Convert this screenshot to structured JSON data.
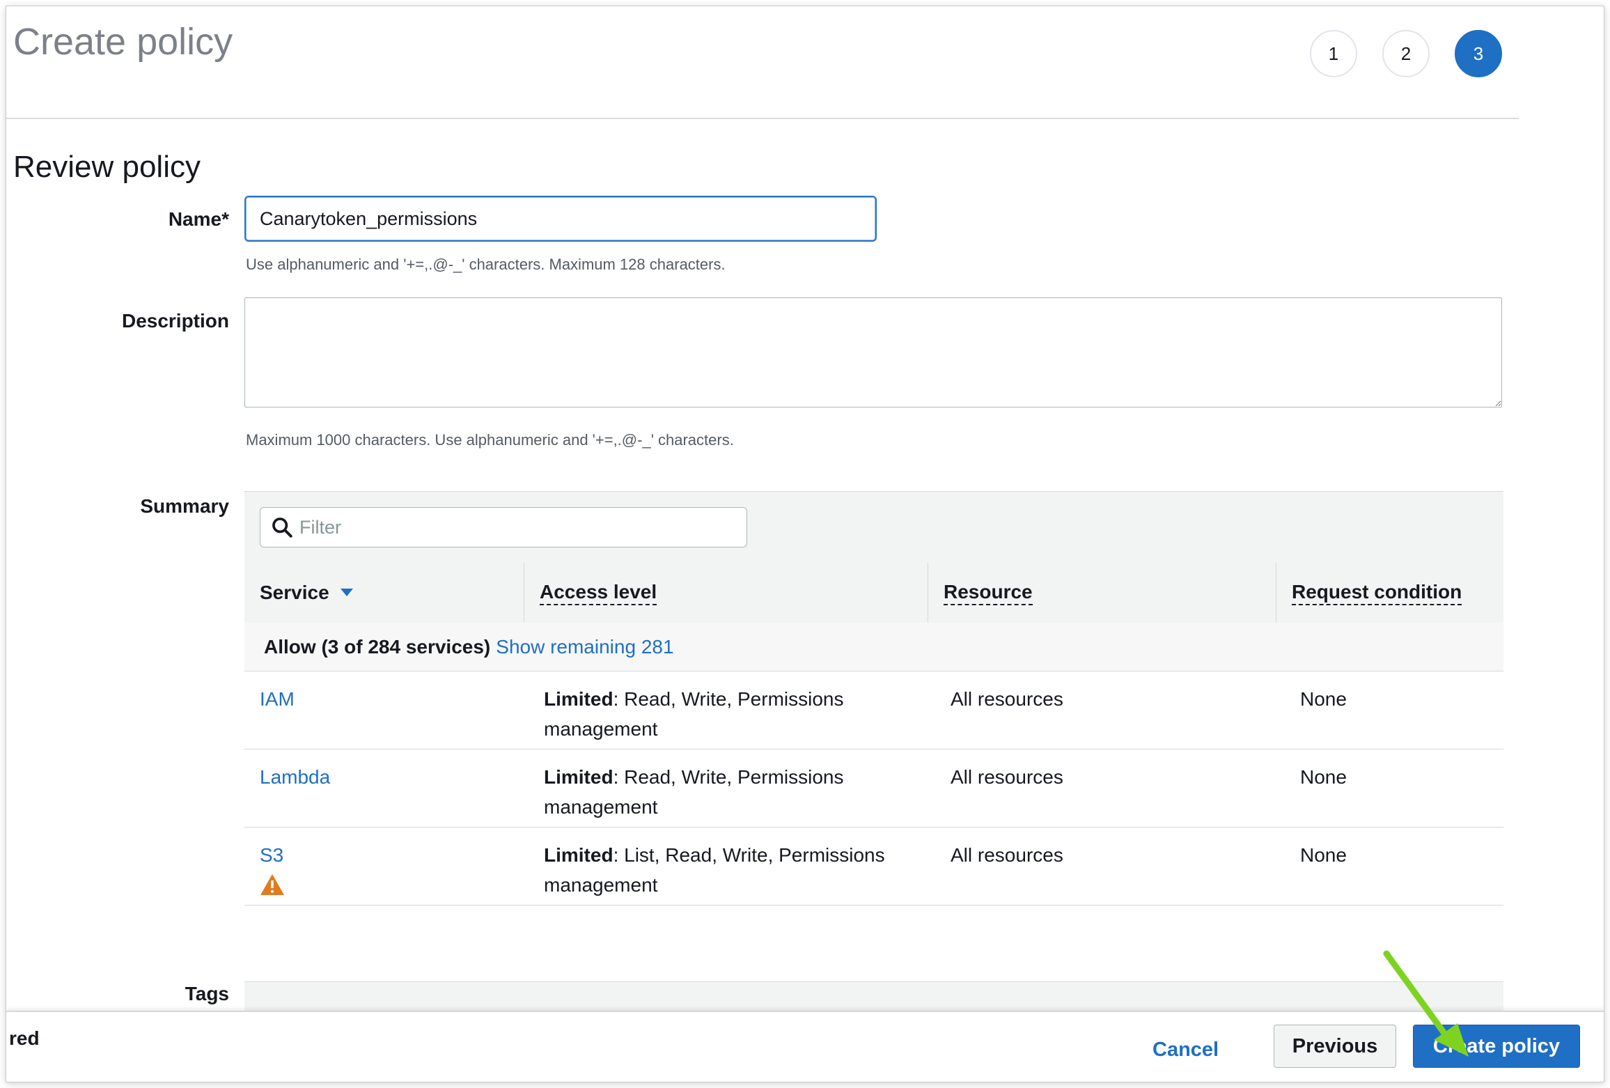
{
  "page": {
    "title": "Create policy"
  },
  "steps": [
    "1",
    "2",
    "3"
  ],
  "section": {
    "title": "Review policy"
  },
  "name_field": {
    "label": "Name*",
    "value": "Canarytoken_permissions",
    "hint": "Use alphanumeric and '+=,.@-_' characters. Maximum 128 characters."
  },
  "description_field": {
    "label": "Description",
    "value": "",
    "hint": "Maximum 1000 characters. Use alphanumeric and '+=,.@-_' characters."
  },
  "summary": {
    "label": "Summary",
    "filter_placeholder": "Filter",
    "columns": [
      "Service",
      "Access level",
      "Resource",
      "Request condition"
    ],
    "group": {
      "prefix": "Allow (3 of 284 services)",
      "link": "Show remaining 281"
    },
    "rows": [
      {
        "service": "IAM",
        "access_strong": "Limited",
        "access_rest": ": Read, Write, Permissions management",
        "resource": "All resources",
        "condition": "None",
        "warning": false
      },
      {
        "service": "Lambda",
        "access_strong": "Limited",
        "access_rest": ": Read, Write, Permissions management",
        "resource": "All resources",
        "condition": "None",
        "warning": false
      },
      {
        "service": "S3",
        "access_strong": "Limited",
        "access_rest": ": List, Read, Write, Permissions management",
        "resource": "All resources",
        "condition": "None",
        "warning": true
      }
    ]
  },
  "tags": {
    "label": "Tags"
  },
  "footer": {
    "left_text": "red",
    "cancel": "Cancel",
    "previous": "Previous",
    "create": "Create policy"
  },
  "colors": {
    "accent": "#1f6fc5",
    "warning": "#e07b1f",
    "annotation_arrow": "#7ed321"
  },
  "icons": {
    "filter": "search-icon",
    "sort": "caret-down-icon",
    "warning": "warning-triangle-icon"
  }
}
